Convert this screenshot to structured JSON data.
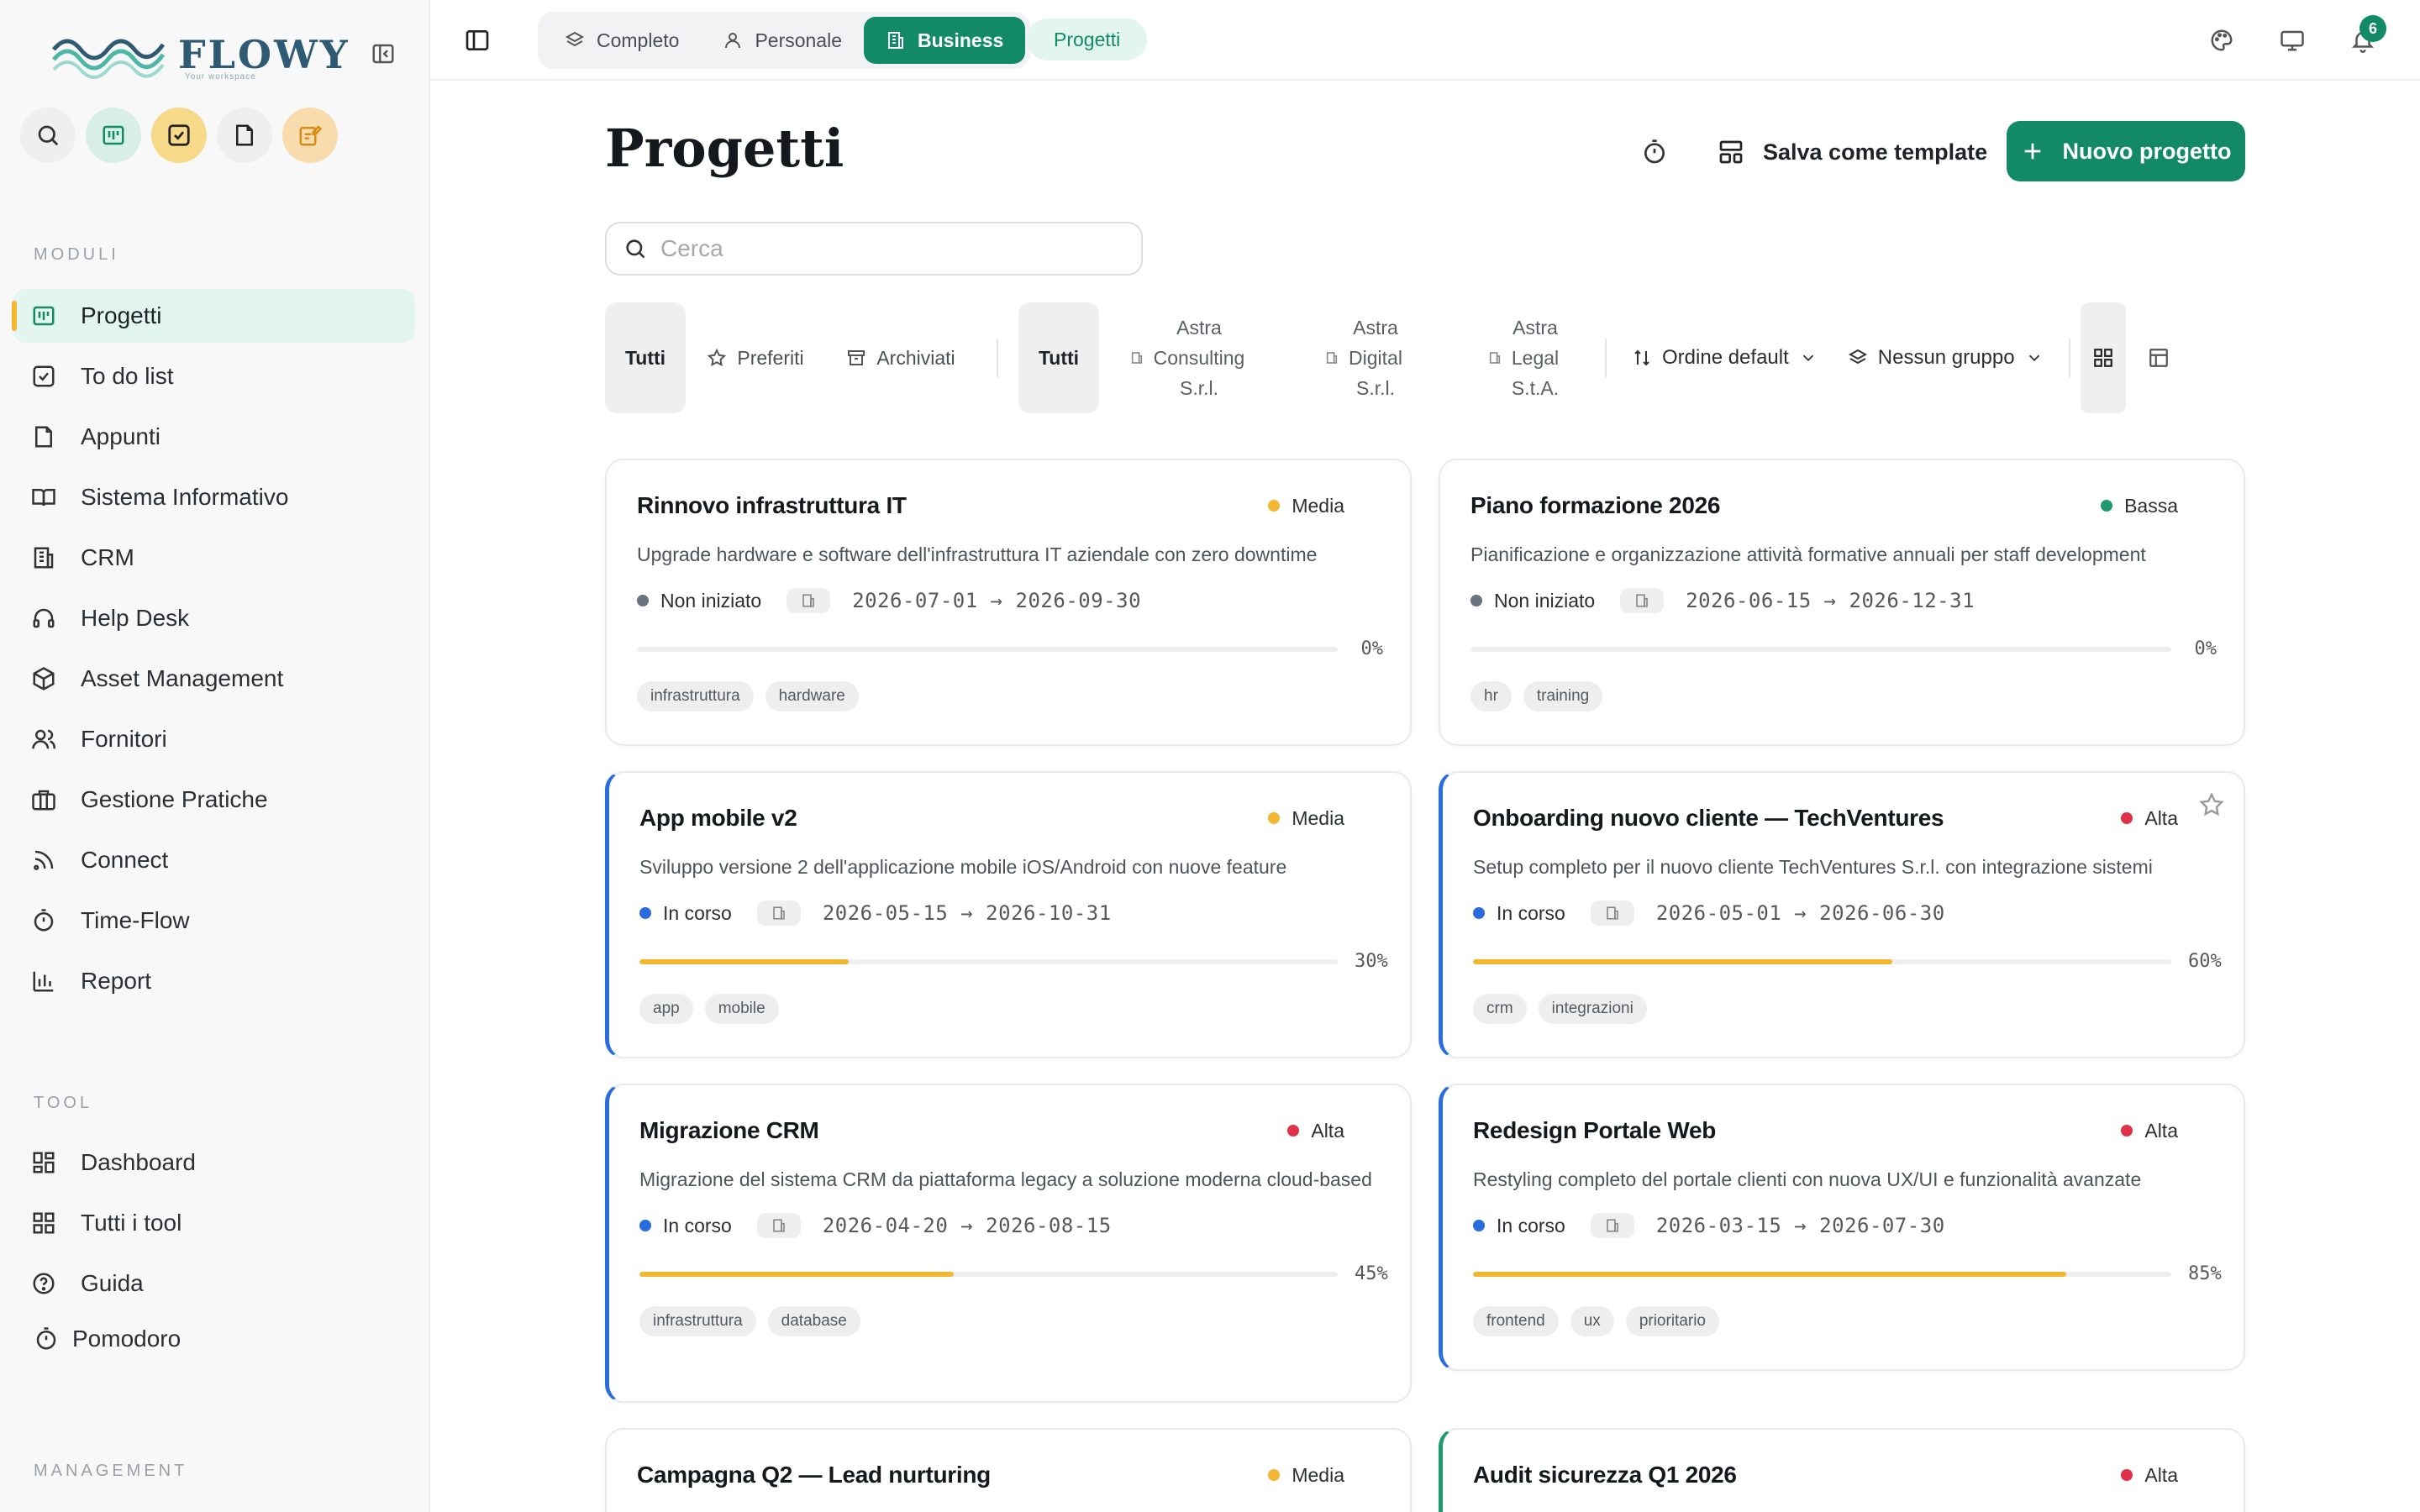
{
  "sidebar": {
    "logo_text": "FLOWY",
    "logo_tag": "Your workspace",
    "sections": {
      "moduli": "MODULI",
      "tool": "TOOL",
      "management": "MANAGEMENT"
    },
    "moduli": [
      {
        "label": "Progetti",
        "icon": "kanban-icon"
      },
      {
        "label": "To do list",
        "icon": "checkbox-icon"
      },
      {
        "label": "Appunti",
        "icon": "note-icon"
      },
      {
        "label": "Sistema Informativo",
        "icon": "book-icon"
      },
      {
        "label": "CRM",
        "icon": "building-icon"
      },
      {
        "label": "Help Desk",
        "icon": "headset-icon"
      },
      {
        "label": "Asset Management",
        "icon": "package-icon"
      },
      {
        "label": "Fornitori",
        "icon": "users-icon"
      },
      {
        "label": "Gestione Pratiche",
        "icon": "briefcase-icon"
      },
      {
        "label": "Connect",
        "icon": "rss-icon"
      },
      {
        "label": "Time-Flow",
        "icon": "timer-icon"
      },
      {
        "label": "Report",
        "icon": "bar-chart-icon"
      }
    ],
    "tool": [
      {
        "label": "Dashboard",
        "icon": "dashboard-icon"
      },
      {
        "label": "Tutti i tool",
        "icon": "grid-icon"
      },
      {
        "label": "Guida",
        "icon": "help-icon"
      }
    ],
    "pomodoro": "Pomodoro"
  },
  "topbar": {
    "workspaces": [
      "Completo",
      "Personale",
      "Business"
    ],
    "active_workspace": "Business",
    "breadcrumb": "Progetti",
    "notifications": "6"
  },
  "main": {
    "title": "Progetti",
    "save_template": "Salva come template",
    "new_project": "Nuovo progetto",
    "search_placeholder": "Cerca",
    "filters": {
      "scope": [
        "Tutti",
        "Preferiti",
        "Archiviati"
      ],
      "company_all": "Tutti",
      "companies": [
        [
          "Astra",
          "Consulting",
          "S.r.l."
        ],
        [
          "Astra",
          "Digital",
          "S.r.l."
        ],
        [
          "Astra",
          "Legal",
          "S.t.A."
        ]
      ],
      "order": "Ordine default",
      "group": "Nessun gruppo"
    }
  },
  "colors": {
    "accent": "#138a66",
    "progress": "#f2b631",
    "media": "#f2b631",
    "bassa": "#1f9a6e",
    "alta": "#e0314b",
    "in_corso": "#2b6be0",
    "non_iniziato": "#6b7280"
  },
  "projects": [
    {
      "title": "Rinnovo infrastruttura IT",
      "priority": "Media",
      "prio_color": "#f2b631",
      "desc": "Upgrade hardware e software dell'infrastruttura IT aziendale con zero downtime",
      "status": "Non iniziato",
      "status_color": "#6b7280",
      "dates": "2026-07-01 → 2026-09-30",
      "progress": 0,
      "progress_label": "0%",
      "tags": [
        "infrastruttura",
        "hardware"
      ]
    },
    {
      "title": "Piano formazione 2026",
      "priority": "Bassa",
      "prio_color": "#1f9a6e",
      "desc": "Pianificazione e organizzazione attività formative annuali per staff development",
      "status": "Non iniziato",
      "status_color": "#6b7280",
      "dates": "2026-06-15 → 2026-12-31",
      "progress": 0,
      "progress_label": "0%",
      "tags": [
        "hr",
        "training"
      ]
    },
    {
      "title": "App mobile v2",
      "priority": "Media",
      "prio_color": "#f2b631",
      "desc": "Sviluppo versione 2 dell'applicazione mobile iOS/Android con nuove feature",
      "status": "In corso",
      "status_color": "#2b6be0",
      "dates": "2026-05-15 → 2026-10-31",
      "progress": 30,
      "progress_label": "30%",
      "tags": [
        "app",
        "mobile"
      ]
    },
    {
      "title": "Onboarding nuovo cliente — TechVentures",
      "priority": "Alta",
      "prio_color": "#e0314b",
      "desc": "Setup completo per il nuovo cliente TechVentures S.r.l. con integrazione sistemi",
      "status": "In corso",
      "status_color": "#2b6be0",
      "dates": "2026-05-01 → 2026-06-30",
      "progress": 60,
      "progress_label": "60%",
      "tags": [
        "crm",
        "integrazioni"
      ]
    },
    {
      "title": "Migrazione CRM",
      "priority": "Alta",
      "prio_color": "#e0314b",
      "desc": "Migrazione del sistema CRM da piattaforma legacy a soluzione moderna cloud-based",
      "status": "In corso",
      "status_color": "#2b6be0",
      "dates": "2026-04-20 → 2026-08-15",
      "progress": 45,
      "progress_label": "45%",
      "tags": [
        "infrastruttura",
        "database"
      ]
    },
    {
      "title": "Redesign Portale Web",
      "priority": "Alta",
      "prio_color": "#e0314b",
      "desc": "Restyling completo del portale clienti con nuova UX/UI e funzionalità avanzate",
      "status": "In corso",
      "status_color": "#2b6be0",
      "dates": "2026-03-15 → 2026-07-30",
      "progress": 85,
      "progress_label": "85%",
      "tags": [
        "frontend",
        "ux",
        "prioritario"
      ]
    },
    {
      "title": "Campagna Q2 — Lead nurturing",
      "priority": "Media",
      "prio_color": "#f2b631"
    },
    {
      "title": "Audit sicurezza Q1 2026",
      "priority": "Alta",
      "prio_color": "#e0314b"
    }
  ]
}
